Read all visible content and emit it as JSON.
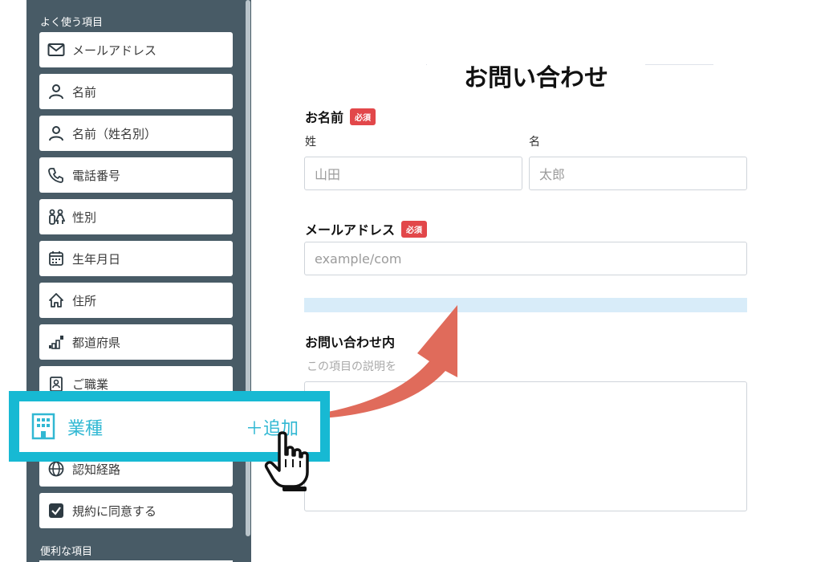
{
  "sidebar": {
    "section_frequent": "よく使う項目",
    "section_useful": "便利な項目",
    "items": [
      {
        "label": "メールアドレス",
        "icon": "mail-icon"
      },
      {
        "label": "名前",
        "icon": "person-icon"
      },
      {
        "label": "名前（姓名別）",
        "icon": "person-icon"
      },
      {
        "label": "電話番号",
        "icon": "phone-icon"
      },
      {
        "label": "性別",
        "icon": "gender-icon"
      },
      {
        "label": "生年月日",
        "icon": "calendar-icon"
      },
      {
        "label": "住所",
        "icon": "home-icon"
      },
      {
        "label": "都道府県",
        "icon": "map-icon"
      },
      {
        "label": "ご職業",
        "icon": "badge-icon"
      },
      {
        "label": "認知経路",
        "icon": "globe-icon"
      },
      {
        "label": "規約に同意する",
        "icon": "checkbox-icon"
      }
    ]
  },
  "dragging": {
    "label": "業種",
    "add_label": "＋追加",
    "icon": "building-icon"
  },
  "form": {
    "title": "お問い合わせ",
    "required_badge": "必須",
    "name": {
      "label": "お名前",
      "last_label": "姓",
      "first_label": "名",
      "last_placeholder": "山田",
      "first_placeholder": "太郎"
    },
    "email": {
      "label": "メールアドレス",
      "placeholder": "example/com"
    },
    "inquiry": {
      "label": "お問い合わせ内",
      "help": "この項目の説明を"
    }
  },
  "colors": {
    "sidebar_bg": "#485b66",
    "accent": "#17b9d3",
    "badge": "#e2474a",
    "arrow": "#e06b5b",
    "drop_zone": "#d8ecf9"
  }
}
